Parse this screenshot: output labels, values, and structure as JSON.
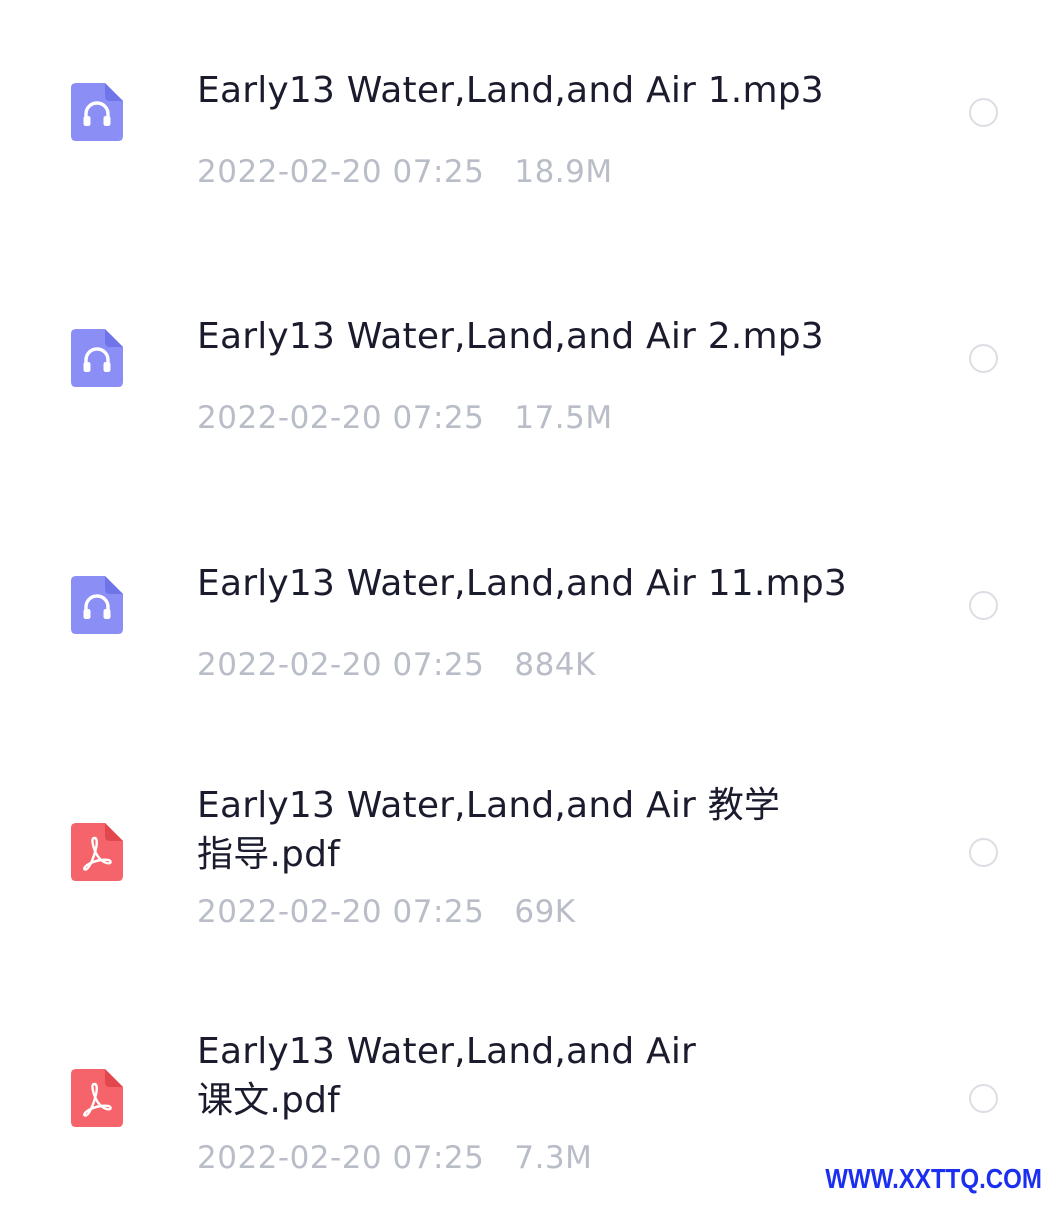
{
  "files": [
    {
      "name": "Early13 Water,Land,and Air 1.mp3",
      "date": "2022-02-20 07:25",
      "size": "18.9M",
      "type": "audio",
      "icon": "headphones-file-icon",
      "icon_color": "#8a8ef5"
    },
    {
      "name": "Early13 Water,Land,and Air 2.mp3",
      "date": "2022-02-20 07:25",
      "size": "17.5M",
      "type": "audio",
      "icon": "headphones-file-icon",
      "icon_color": "#8a8ef5"
    },
    {
      "name": "Early13 Water,Land,and Air 11.mp3",
      "date": "2022-02-20 07:25",
      "size": "884K",
      "type": "audio",
      "icon": "headphones-file-icon",
      "icon_color": "#8a8ef5"
    },
    {
      "name": "Early13 Water,Land,and Air 教学\n指导.pdf",
      "date": "2022-02-20 07:25",
      "size": "69K",
      "type": "pdf",
      "icon": "pdf-file-icon",
      "icon_color": "#f5646a"
    },
    {
      "name": "Early13 Water,Land,and Air\n课文.pdf",
      "date": "2022-02-20 07:25",
      "size": "7.3M",
      "type": "pdf",
      "icon": "pdf-file-icon",
      "icon_color": "#f5646a"
    }
  ],
  "watermark": "WWW.XXTTQ.COM",
  "colors": {
    "audio_icon": "#8a8ef5",
    "pdf_icon": "#f5646a",
    "name_text": "#1b1b2e",
    "meta_text": "#b9bdc7",
    "radio_border": "#dcdee3",
    "watermark": "#1a2ff0"
  }
}
